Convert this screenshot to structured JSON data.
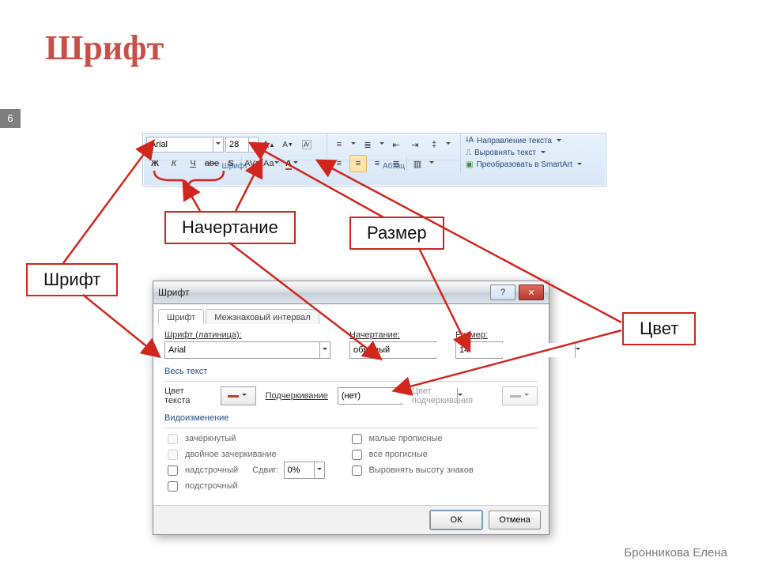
{
  "page": {
    "title": "Шрифт",
    "badge": "6",
    "author": "Бронникова Елена"
  },
  "callouts": {
    "begin": "Начертание",
    "size": "Размер",
    "font": "Шрифт",
    "color": "Цвет"
  },
  "ribbon": {
    "fontGrp": "Шрифт",
    "paraGrp": "Абзац",
    "fontName": "Arial",
    "fontSize": "28",
    "bold": "Ж",
    "italic": "К",
    "underline": "Ч",
    "strike": "abe",
    "shadow": "S",
    "spacing": "AV",
    "changeCase": "Aa",
    "fontColor": "A",
    "menu1": "Направление текста",
    "menu2": "Выровнять текст",
    "menu3": "Преобразовать в SmartArt"
  },
  "dlg": {
    "title": "Шрифт",
    "tab1": "Шрифт",
    "tab2": "Межзнаковый интервал",
    "fontLatinLbl": "Шрифт (латиница):",
    "fontLatinVal": "Arial",
    "styleLbl": "Начертание:",
    "styleVal": "обычный",
    "sizeLbl": "Размер:",
    "sizeVal": "14",
    "allText": "Весь текст",
    "textColorLbl": "Цвет текста",
    "underlineLbl": "Подчеркивание",
    "underlineVal": "(нет)",
    "underlineColorLbl": "Цвет подчеркивания",
    "effectsHdr": "Видоизменение",
    "chkStrike": "зачеркнутый",
    "chkDblStrike": "двойное зачеркивание",
    "chkSuper": "надстрочный",
    "chkSub": "подстрочный",
    "offsetLbl": "Сдвиг:",
    "offsetVal": "0%",
    "chkSmallCaps": "малые прописные",
    "chkAllCaps": "все прогисные",
    "chkEqualize": "Выровнять высоту знаков",
    "ok": "ОК",
    "cancel": "Отмена"
  },
  "colors": {
    "accent": "#d1261e"
  }
}
